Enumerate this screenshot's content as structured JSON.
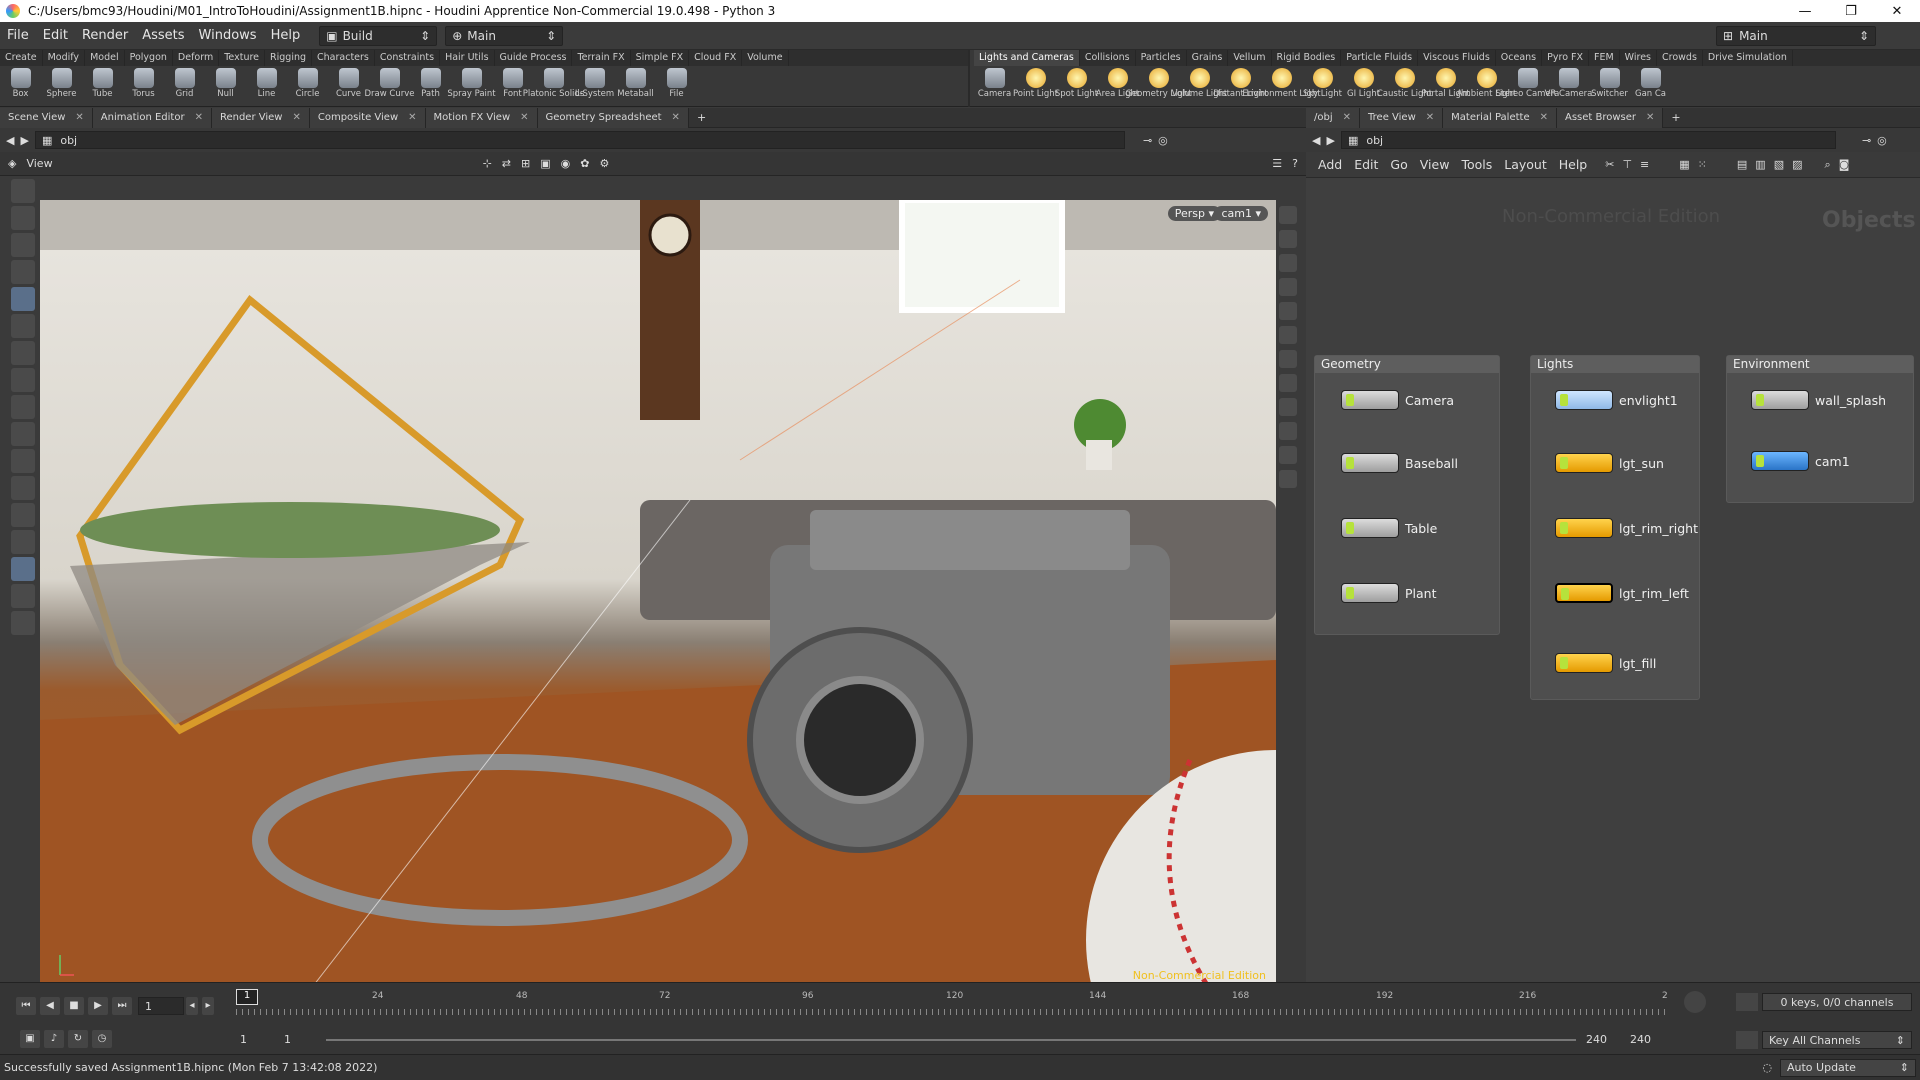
{
  "window": {
    "title": "C:/Users/bmc93/Houdini/M01_IntroToHoudini/Assignment1B.hipnc - Houdini Apprentice Non-Commercial 19.0.498 - Python 3"
  },
  "menu": {
    "items": [
      "File",
      "Edit",
      "Render",
      "Assets",
      "Windows",
      "Help"
    ]
  },
  "desktop": {
    "build": "Build",
    "main": "Main",
    "right_main": "Main"
  },
  "shelf_left": {
    "tabs": [
      "Create",
      "Modify",
      "Model",
      "Polygon",
      "Deform",
      "Texture",
      "Rigging",
      "Characters",
      "Constraints",
      "Hair Utils",
      "Guide Process",
      "Terrain FX",
      "Simple FX",
      "Cloud FX",
      "Volume"
    ],
    "tools": [
      "Box",
      "Sphere",
      "Tube",
      "Torus",
      "Grid",
      "Null",
      "Line",
      "Circle",
      "Curve",
      "Draw Curve",
      "Path",
      "Spray Paint",
      "Font",
      "Platonic Solids",
      "L-System",
      "Metaball",
      "File"
    ]
  },
  "shelf_right": {
    "tabs": [
      "Lights and Cameras",
      "Collisions",
      "Particles",
      "Grains",
      "Vellum",
      "Rigid Bodies",
      "Particle Fluids",
      "Viscous Fluids",
      "Oceans",
      "Pyro FX",
      "FEM",
      "Wires",
      "Crowds",
      "Drive Simulation"
    ],
    "tools": [
      "Camera",
      "Point Light",
      "Spot Light",
      "Area Light",
      "Geometry Light",
      "Volume Light",
      "Distant Light",
      "Environment Light",
      "Sky Light",
      "GI Light",
      "Caustic Light",
      "Portal Light",
      "Ambient Light",
      "Stereo Camera",
      "VR Camera",
      "Switcher",
      "Gan Ca"
    ]
  },
  "left_panel": {
    "tabs": [
      "Scene View",
      "Animation Editor",
      "Render View",
      "Composite View",
      "Motion FX View",
      "Geometry Spreadsheet"
    ],
    "path": "obj",
    "view_label": "View",
    "persp": "Persp ▾",
    "camera": "cam1 ▾",
    "watermark": "Non-Commercial Edition"
  },
  "right_panel": {
    "tabs": [
      "/obj",
      "Tree View",
      "Material Palette",
      "Asset Browser"
    ],
    "path": "obj",
    "menu": [
      "Add",
      "Edit",
      "Go",
      "View",
      "Tools",
      "Layout",
      "Help"
    ],
    "watermark": "Non-Commercial Edition",
    "context": "Objects",
    "boxes": [
      {
        "title": "Geometry",
        "nodes": [
          "Camera",
          "Baseball",
          "Table",
          "Plant"
        ]
      },
      {
        "title": "Lights",
        "nodes": [
          "envlight1",
          "lgt_sun",
          "lgt_rim_right",
          "lgt_rim_left",
          "lgt_fill"
        ]
      },
      {
        "title": "Environment",
        "nodes": [
          "wall_splash",
          "cam1"
        ]
      }
    ]
  },
  "timeline": {
    "ticks": [
      "24",
      "48",
      "72",
      "96",
      "120",
      "144",
      "168",
      "192",
      "216",
      "2"
    ],
    "current_frame": "1",
    "start_frame": "1",
    "start_frame2": "1",
    "end_frame": "240",
    "end_frame2": "240",
    "marker": "1",
    "keys": "0 keys, 0/0 channels",
    "key_all": "Key All Channels",
    "auto_update": "Auto Update"
  },
  "status": {
    "message": "Successfully saved Assignment1B.hipnc (Mon Feb  7 13:42:08 2022)"
  }
}
